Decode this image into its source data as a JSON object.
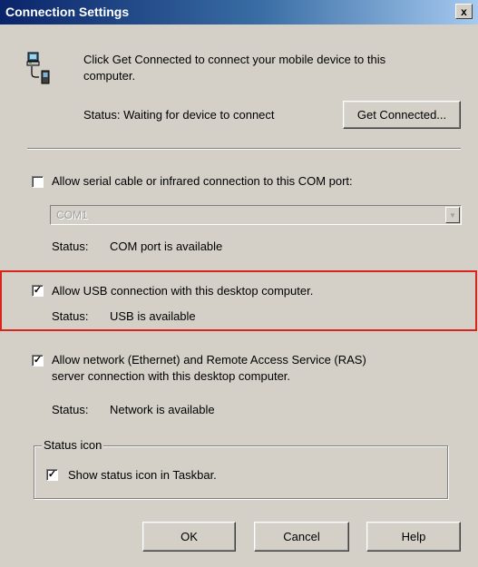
{
  "window": {
    "title": "Connection Settings",
    "close_symbol": "x"
  },
  "connect": {
    "instruction_line1": "Click Get Connected to connect your mobile device to this",
    "instruction_line2": "computer.",
    "status": "Status: Waiting for device to connect",
    "get_connected_label": "Get Connected..."
  },
  "serial": {
    "checkbox_label": "Allow serial cable or infrared connection to this COM port:",
    "checked": false,
    "port_selected": "COM1",
    "status_label": "Status:",
    "status_value": "COM port is available"
  },
  "usb": {
    "checkbox_label": "Allow USB connection with this desktop computer.",
    "checked": true,
    "check_mark": "✓",
    "status_label": "Status:",
    "status_value": "USB is available"
  },
  "network": {
    "checkbox_label_line1": "Allow network (Ethernet) and Remote Access Service (RAS)",
    "checkbox_label_line2": "server connection with this desktop computer.",
    "checked": true,
    "check_mark": "✓",
    "status_label": "Status:",
    "status_value": "Network is available"
  },
  "status_icon_group": {
    "title": "Status icon",
    "checkbox_label": "Show status icon in Taskbar.",
    "checked": true,
    "check_mark": "✓"
  },
  "buttons": {
    "ok_label": "OK",
    "cancel_label": "Cancel",
    "help_label": "Help"
  },
  "colors": {
    "highlight_border": "#d9241b",
    "title_bar_start": "#0a246a",
    "dialog_face": "#d4d0c8"
  },
  "icons": {
    "device": "pc-and-mobile-device-icon",
    "close": "close-icon",
    "dropdown": "chevron-down-icon"
  }
}
